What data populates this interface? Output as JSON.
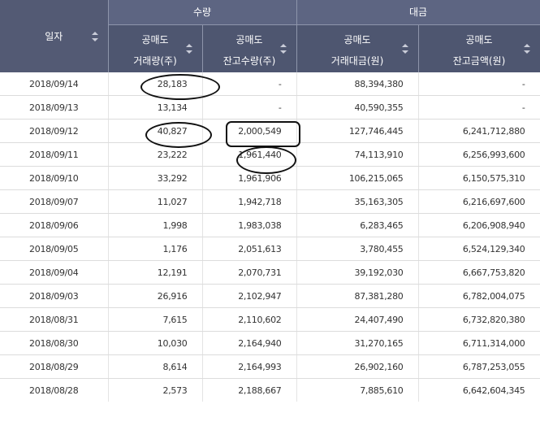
{
  "header": {
    "date": "일자",
    "group_qty": "수량",
    "group_amt": "대금",
    "cols": [
      {
        "line1": "공매도",
        "line2": "거래량(주)"
      },
      {
        "line1": "공매도",
        "line2": "잔고수량(주)"
      },
      {
        "line1": "공매도",
        "line2": "거래대금(원)"
      },
      {
        "line1": "공매도",
        "line2": "잔고금액(원)"
      }
    ]
  },
  "rows": [
    [
      "2018/09/14",
      "28,183",
      "-",
      "88,394,380",
      "-"
    ],
    [
      "2018/09/13",
      "13,134",
      "-",
      "40,590,355",
      "-"
    ],
    [
      "2018/09/12",
      "40,827",
      "2,000,549",
      "127,746,445",
      "6,241,712,880"
    ],
    [
      "2018/09/11",
      "23,222",
      "1,961,440",
      "74,113,910",
      "6,256,993,600"
    ],
    [
      "2018/09/10",
      "33,292",
      "1,961,906",
      "106,215,065",
      "6,150,575,310"
    ],
    [
      "2018/09/07",
      "11,027",
      "1,942,718",
      "35,163,305",
      "6,216,697,600"
    ],
    [
      "2018/09/06",
      "1,998",
      "1,983,038",
      "6,283,465",
      "6,206,908,940"
    ],
    [
      "2018/09/05",
      "1,176",
      "2,051,613",
      "3,780,455",
      "6,524,129,340"
    ],
    [
      "2018/09/04",
      "12,191",
      "2,070,731",
      "39,192,030",
      "6,667,753,820"
    ],
    [
      "2018/09/03",
      "26,916",
      "2,102,947",
      "87,381,280",
      "6,782,004,075"
    ],
    [
      "2018/08/31",
      "7,615",
      "2,110,602",
      "24,407,490",
      "6,732,820,380"
    ],
    [
      "2018/08/30",
      "10,030",
      "2,164,940",
      "31,270,165",
      "6,711,314,000"
    ],
    [
      "2018/08/29",
      "8,614",
      "2,164,993",
      "26,902,160",
      "6,787,253,055"
    ],
    [
      "2018/08/28",
      "2,573",
      "2,188,667",
      "7,885,610",
      "6,642,604,345"
    ]
  ]
}
